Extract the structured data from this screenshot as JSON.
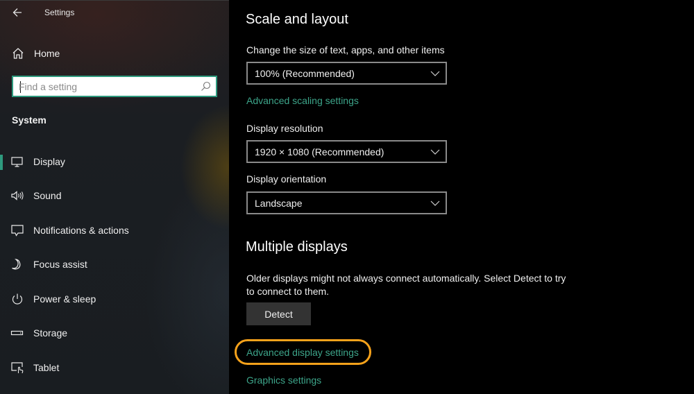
{
  "window": {
    "title": "Settings"
  },
  "sidebar": {
    "home_label": "Home",
    "search": {
      "placeholder": "Find a setting",
      "value": ""
    },
    "section_title": "System",
    "items": [
      {
        "label": "Display",
        "icon": "monitor-icon",
        "selected": true
      },
      {
        "label": "Sound",
        "icon": "speaker-icon",
        "selected": false
      },
      {
        "label": "Notifications & actions",
        "icon": "notification-icon",
        "selected": false
      },
      {
        "label": "Focus assist",
        "icon": "moon-icon",
        "selected": false
      },
      {
        "label": "Power & sleep",
        "icon": "power-icon",
        "selected": false
      },
      {
        "label": "Storage",
        "icon": "storage-icon",
        "selected": false
      },
      {
        "label": "Tablet",
        "icon": "tablet-icon",
        "selected": false
      }
    ]
  },
  "main": {
    "scale_section": {
      "title": "Scale and layout",
      "size_label": "Change the size of text, apps, and other items",
      "size_value": "100% (Recommended)",
      "advanced_scaling_link": "Advanced scaling settings",
      "resolution_label": "Display resolution",
      "resolution_value": "1920 × 1080 (Recommended)",
      "orientation_label": "Display orientation",
      "orientation_value": "Landscape"
    },
    "multiple_displays": {
      "title": "Multiple displays",
      "description": "Older displays might not always connect automatically. Select Detect to try to connect to them.",
      "detect_button": "Detect",
      "advanced_display_link": "Advanced display settings",
      "graphics_link": "Graphics settings"
    }
  },
  "colors": {
    "accent": "#2e9a7e",
    "link": "#3da58a",
    "highlight": "#f7a21b"
  }
}
